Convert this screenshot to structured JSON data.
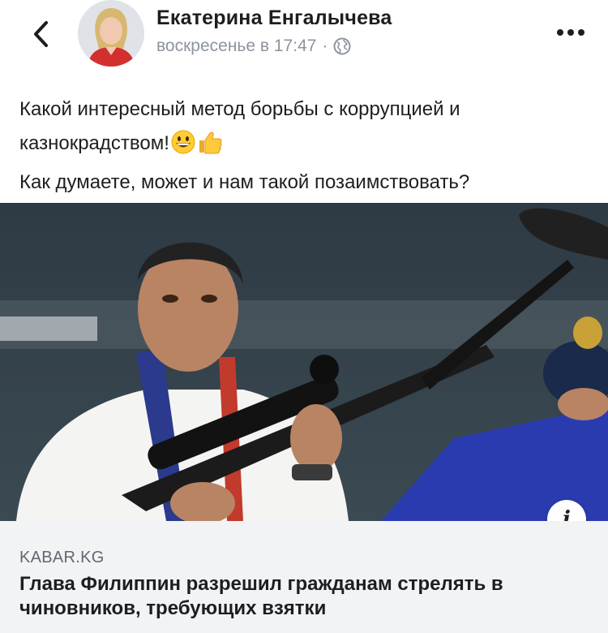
{
  "header": {
    "author_name": "Екатерина Енгалычева",
    "timestamp": "воскресенье в 17:47",
    "separator": "·",
    "privacy_icon": "globe-icon",
    "back_icon": "chevron-left-icon",
    "more_icon": "more-dots-icon"
  },
  "post": {
    "line1": "Какой интересный метод борьбы с коррупцией и",
    "line2": "казнокрадством!",
    "emoji1": "grinning-face-emoji",
    "emoji2": "thumbs-up-emoji",
    "line3": "Как думаете, может и нам такой позаимствовать?"
  },
  "link_preview": {
    "info_label": "i",
    "domain": "KABAR.KG",
    "headline": "Глава Филиппин разрешил гражданам стрелять в чиновников, требующих взятки"
  },
  "colors": {
    "text": "#1c1e21",
    "meta": "#8d949e",
    "link_bg": "#f2f3f5",
    "domain": "#606770"
  }
}
